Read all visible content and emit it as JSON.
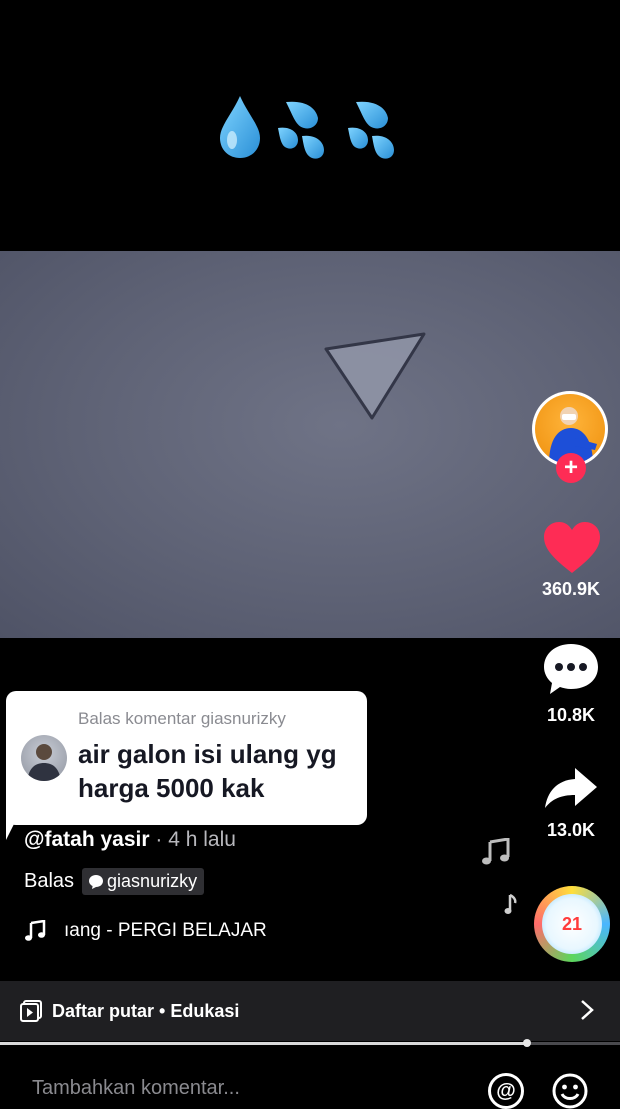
{
  "overlay": {
    "emoji": [
      "💧",
      "💦",
      "💦"
    ]
  },
  "creator": {
    "follow_symbol": "+"
  },
  "actions": {
    "likes": "360.9K",
    "comments": "10.8K",
    "shares": "13.0K"
  },
  "reply_sticker": {
    "header": "Balas komentar giasnurizky",
    "text": "air galon isi ulang yg harga 5000 kak"
  },
  "post": {
    "author": "@fatah yasir",
    "meta": " · 4 h lalu",
    "reply_label": "Balas",
    "reply_user": "giasnurizky",
    "music": "ıang - PERGI BELAJAR",
    "disc_badge": "21"
  },
  "playlist": {
    "label": "Daftar putar • Edukasi"
  },
  "progress": {
    "fraction": 0.85
  },
  "comment_box": {
    "placeholder": "Tambahkan komentar..."
  },
  "colors": {
    "like_red": "#fe2c55",
    "accent": "#fe2c55"
  }
}
